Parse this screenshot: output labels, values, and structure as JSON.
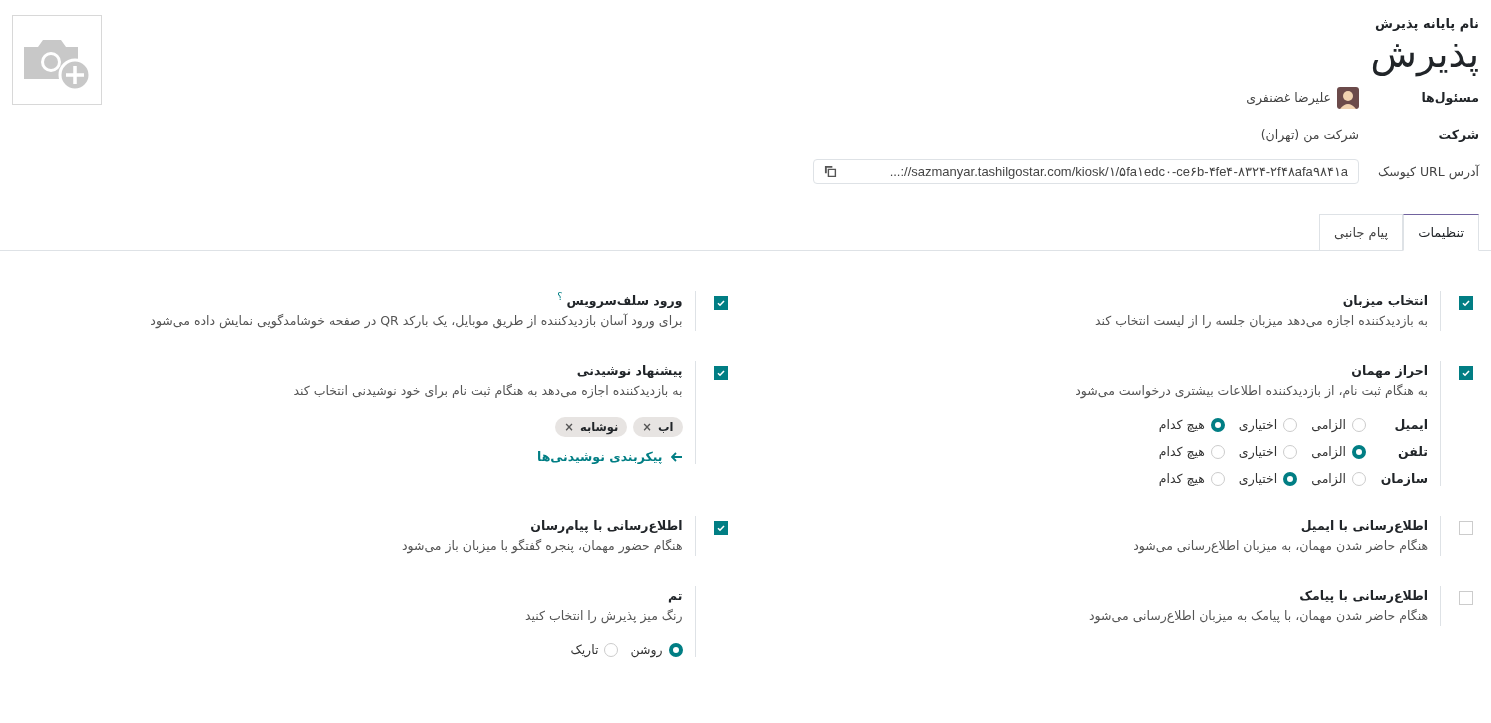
{
  "header": {
    "name_label": "نام پایانه پذیرش",
    "name": "پذیرش",
    "fields": [
      {
        "kind": "user",
        "label": "مسئول‌ها",
        "value": "علیرضا غضنفری"
      },
      {
        "kind": "text",
        "label": "شرکت",
        "value": "شرکت من (تهران)"
      },
      {
        "kind": "url",
        "label": "آدرس URL کیوسک",
        "value": "...://sazmanyar.tashilgostar.com/kiosk/۱/۵fa۱edc۰-ce۶b-۴fe۴-۸۳۲۴-۲f۴۸afa۹۸۴۱a"
      }
    ]
  },
  "tabs": [
    {
      "label": "تنظیمات",
      "selected": true
    },
    {
      "label": "پیام جانبی",
      "selected": false
    }
  ],
  "settings": [
    {
      "kind": "checkbox",
      "checked": true,
      "title": "انتخاب میزبان",
      "description": "به بازدیدکننده اجازه می‌دهد میزبان جلسه را از لیست انتخاب کند"
    },
    {
      "kind": "checkbox",
      "checked": true,
      "title": "ورود سلف‌سرویس",
      "help": "؟",
      "description": "برای ورود آسان بازدیدکننده از طریق موبایل، یک بارکد QR در صفحه خوشامدگویی نمایش داده می‌شود"
    },
    {
      "kind": "checkbox",
      "checked": true,
      "title": "احراز مهمان",
      "description": "به هنگام ثبت نام، از بازدیدکننده اطلاعات بیشتری درخواست می‌شود",
      "radio_rows": [
        {
          "label": "ایمیل",
          "options": [
            {
              "label": "الزامی",
              "selected": false
            },
            {
              "label": "اختیاری",
              "selected": false
            },
            {
              "label": "هیچ کدام",
              "selected": true
            }
          ]
        },
        {
          "label": "تلفن",
          "options": [
            {
              "label": "الزامی",
              "selected": true
            },
            {
              "label": "اختیاری",
              "selected": false
            },
            {
              "label": "هیچ کدام",
              "selected": false
            }
          ]
        },
        {
          "label": "سازمان",
          "options": [
            {
              "label": "الزامی",
              "selected": false
            },
            {
              "label": "اختیاری",
              "selected": true
            },
            {
              "label": "هیچ کدام",
              "selected": false
            }
          ]
        }
      ]
    },
    {
      "kind": "checkbox",
      "checked": true,
      "title": "پیشنهاد نوشیدنی",
      "description": "به بازدیدکننده اجازه می‌دهد به هنگام ثبت نام برای خود نوشیدنی انتخاب کند",
      "tags": [
        {
          "label": "اب",
          "remove": "×"
        },
        {
          "label": "نوشابه",
          "remove": "×"
        }
      ],
      "link": "پیکربندی نوشیدنی‌ها"
    },
    {
      "kind": "checkbox",
      "checked": false,
      "title": "اطلاع‌رسانی با ایمیل",
      "description": "هنگام حاضر شدن مهمان، به میزبان اطلاع‌رسانی می‌شود"
    },
    {
      "kind": "checkbox",
      "checked": true,
      "title": "اطلاع‌رسانی با پیام‌رسان",
      "description": "هنگام حضور مهمان، پنجره گفتگو با میزبان باز می‌شود"
    },
    {
      "kind": "checkbox",
      "checked": false,
      "title": "اطلاع‌رسانی با پیامک",
      "description": "هنگام حاضر شدن مهمان، با پیامک به میزبان اطلاع‌رسانی می‌شود"
    },
    {
      "kind": "plain",
      "title": "تم",
      "description": "رنگ میز پذیرش را انتخاب کنید",
      "options": [
        {
          "label": "روشن",
          "selected": true
        },
        {
          "label": "تاریک",
          "selected": false
        }
      ]
    }
  ]
}
